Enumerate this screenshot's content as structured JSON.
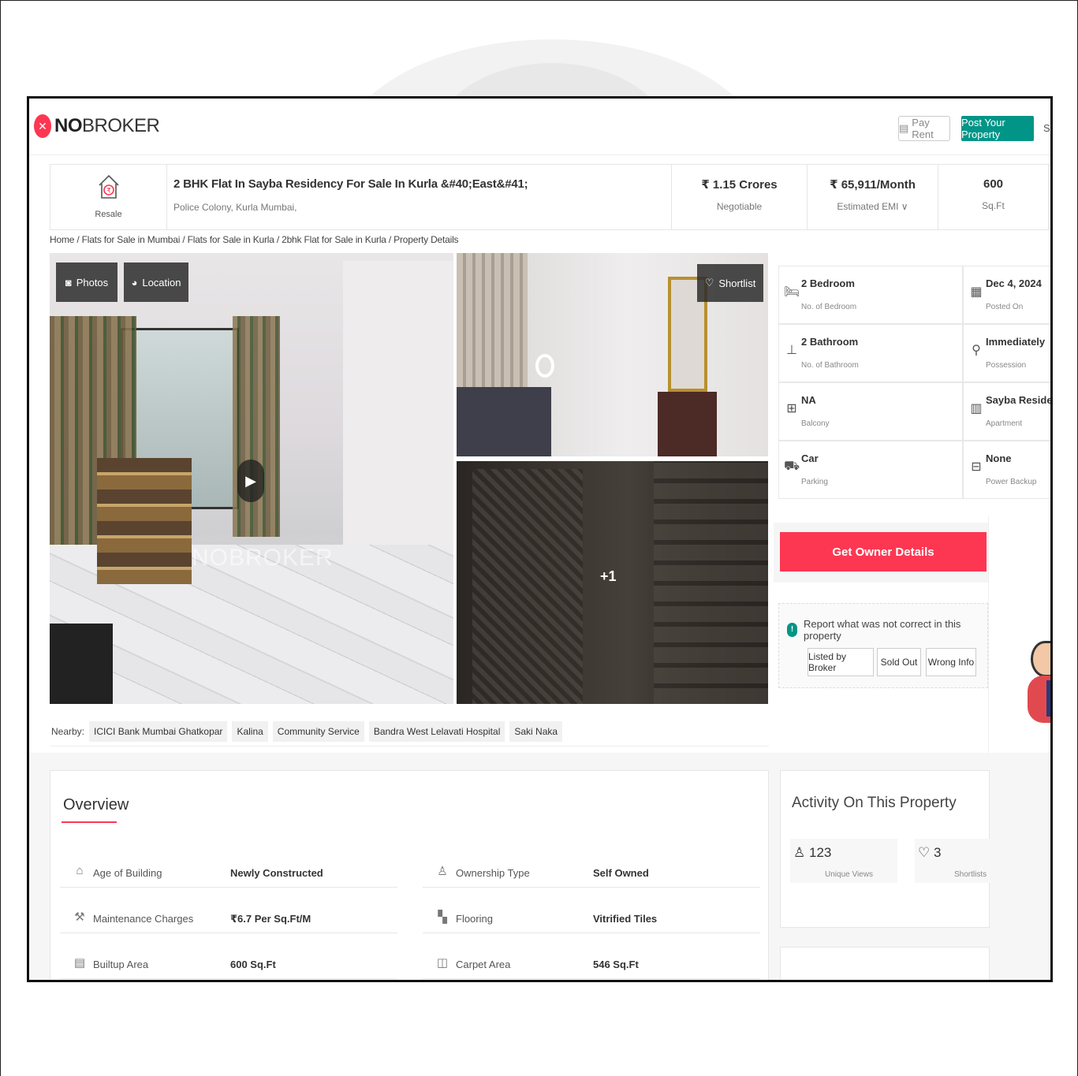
{
  "header": {
    "brand_bold": "NO",
    "brand_light": "BROKER",
    "pay_rent": "Pay Rent",
    "post_property": "Post Your Property",
    "sign_cut": "Si"
  },
  "summary": {
    "type_label": "Resale",
    "title": "2 BHK Flat In Sayba Residency For Sale In Kurla &#40;East&#41;",
    "location": "Police Colony, Kurla Mumbai,",
    "price": "₹ 1.15 Crores",
    "price_note": "Negotiable",
    "emi": "₹ 65,911/Month",
    "emi_note": "Estimated EMI ∨",
    "area": "600",
    "area_unit": "Sq.Ft"
  },
  "breadcrumb": "Home / Flats for Sale in Mumbai / Flats for Sale in Kurla / 2bhk Flat for Sale in Kurla / Property Details",
  "gallery": {
    "photos_label": "Photos",
    "location_label": "Location",
    "shortlist_label": "Shortlist",
    "more_count": "+1",
    "watermark": "NOBROKER"
  },
  "specs": [
    {
      "value": "2 Bedroom",
      "label": "No. of Bedroom",
      "icon": "bed-icon"
    },
    {
      "value": "Dec 4, 2024",
      "label": "Posted On",
      "icon": "calendar-icon"
    },
    {
      "value": "2 Bathroom",
      "label": "No. of Bathroom",
      "icon": "bath-icon"
    },
    {
      "value": "Immediately",
      "label": "Possession",
      "icon": "key-icon"
    },
    {
      "value": "NA",
      "label": "Balcony",
      "icon": "balcony-icon"
    },
    {
      "value": "Sayba Residency",
      "label": "Apartment",
      "icon": "building-icon"
    },
    {
      "value": "Car",
      "label": "Parking",
      "icon": "car-icon"
    },
    {
      "value": "None",
      "label": "Power Backup",
      "icon": "battery-icon"
    }
  ],
  "owner_button": "Get Owner Details",
  "report": {
    "title": "Report what was not correct in this property",
    "chips": [
      "Listed by Broker",
      "Sold Out",
      "Wrong Info"
    ]
  },
  "nearby": {
    "label": "Nearby:",
    "places": [
      "ICICI Bank Mumbai Ghatkopar",
      "Kalina",
      "Community Service",
      "Bandra West Lelavati Hospital",
      "Saki Naka"
    ]
  },
  "overview": {
    "title": "Overview",
    "rows": [
      {
        "key": "Age of Building",
        "value": "Newly Constructed",
        "icon": "building-age-icon"
      },
      {
        "key": "Ownership Type",
        "value": "Self Owned",
        "icon": "ownership-icon"
      },
      {
        "key": "Maintenance Charges",
        "value": "₹6.7 Per Sq.Ft/M",
        "icon": "maintenance-icon"
      },
      {
        "key": "Flooring",
        "value": "Vitrified Tiles",
        "icon": "flooring-icon"
      },
      {
        "key": "Builtup Area",
        "value": "600 Sq.Ft",
        "icon": "builtup-icon"
      },
      {
        "key": "Carpet Area",
        "value": "546 Sq.Ft",
        "icon": "carpet-icon"
      }
    ]
  },
  "activity": {
    "title": "Activity On This Property",
    "views": "123",
    "views_label": "Unique Views",
    "shortlists": "3",
    "shortlists_label": "Shortlists"
  },
  "colors": {
    "brand_red": "#fd3752",
    "brand_green": "#009587"
  }
}
